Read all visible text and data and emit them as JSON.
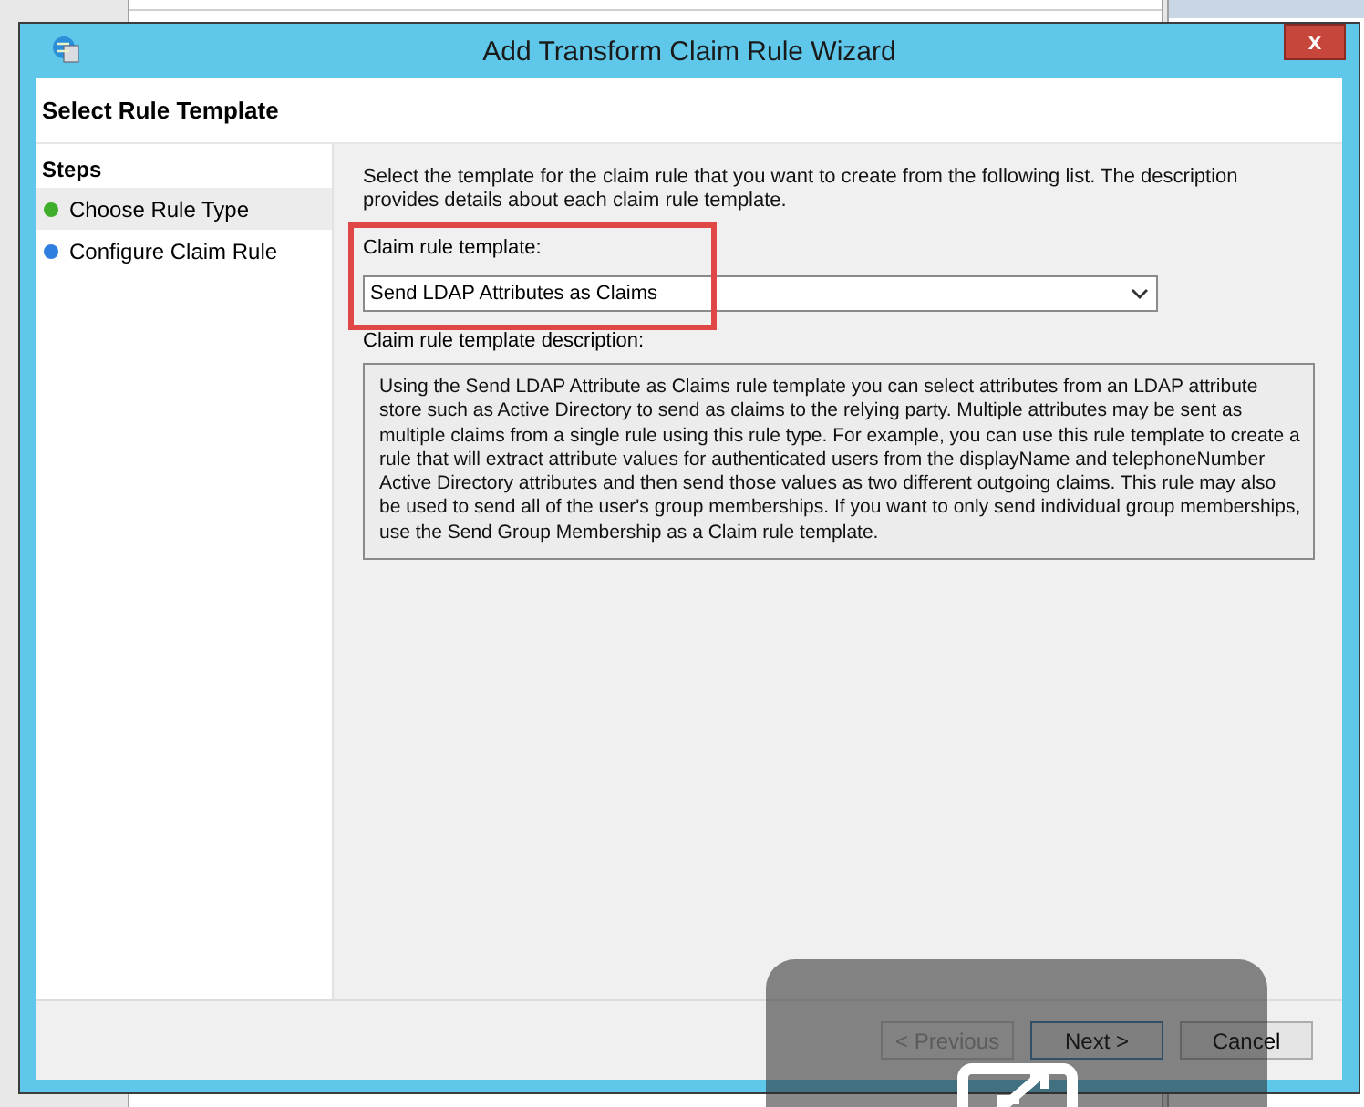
{
  "window": {
    "title": "Add Transform Claim Rule Wizard",
    "close": "x"
  },
  "page_title": "Select Rule Template",
  "steps": {
    "title": "Steps",
    "items": [
      {
        "label": "Choose Rule Type",
        "selected": true,
        "color": "#3fae2a"
      },
      {
        "label": "Configure Claim Rule",
        "selected": false,
        "color": "#2f7fe0"
      }
    ]
  },
  "intro": "Select the template for the claim rule that you want to create from the following list. The description provides details about each claim rule template.",
  "template_field": {
    "label": "Claim rule template:",
    "value": "Send LDAP Attributes as Claims",
    "highlighted": true
  },
  "description": {
    "label": "Claim rule template description:",
    "text": "Using the Send LDAP Attribute as Claims rule template you can select attributes from an LDAP attribute store such as Active Directory to send as claims to the relying party. Multiple attributes may be sent as multiple claims from a single rule using this rule type. For example, you can use this rule template to create a rule that will extract attribute values for authenticated users from the displayName and telephoneNumber Active Directory attributes and then send those values as two different outgoing claims. This rule may also be used to send all of the user's group memberships. If you want to only send individual group memberships, use the Send Group Membership as a Claim rule template."
  },
  "buttons": [
    {
      "label": "< Previous",
      "disabled": true
    },
    {
      "label": "Next >",
      "disabled": false
    },
    {
      "label": "Cancel",
      "disabled": false
    }
  ]
}
